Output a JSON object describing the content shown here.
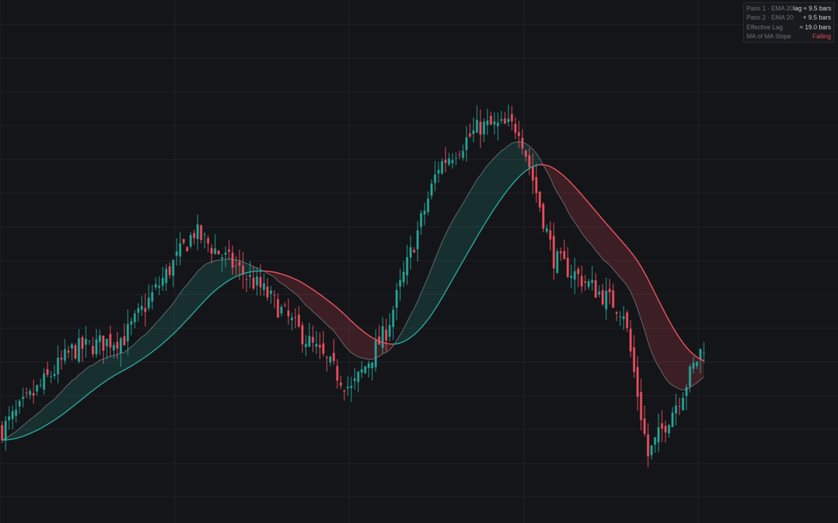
{
  "legend": [
    {
      "label": "Pass 1 · EMA 20",
      "value": "lag ≈ 9.5 bars"
    },
    {
      "label": "Pass 2 · EMA 20",
      "value": "+ 9.5 bars"
    },
    {
      "label": "Effective Lag",
      "value": "≈ 19.0 bars"
    },
    {
      "label": "MA of MA Slope",
      "value": "Falling"
    }
  ],
  "colors": {
    "background": "#141518",
    "grid": "#202226",
    "up": "#26a69a",
    "down": "#ef4f5f",
    "falling": "#e8495a"
  },
  "chart_data": {
    "type": "candlestick",
    "grid": true,
    "axes_labels_shown": false,
    "candle_count": 202,
    "series": [
      {
        "name": "Pass 1 · EMA 20",
        "period": 20
      },
      {
        "name": "Pass 2 · EMA 20",
        "period": 20
      }
    ],
    "price_path": [
      [
        0,
        100
      ],
      [
        20,
        112
      ],
      [
        35,
        114
      ],
      [
        55,
        130
      ],
      [
        75,
        121
      ],
      [
        100,
        106
      ],
      [
        110,
        115
      ],
      [
        125,
        140
      ],
      [
        137,
        146
      ],
      [
        148,
        146
      ],
      [
        158,
        126
      ],
      [
        178,
        118
      ],
      [
        185,
        96
      ],
      [
        195,
        106
      ],
      [
        201,
        113
      ]
    ],
    "ma_slope": "Falling"
  }
}
